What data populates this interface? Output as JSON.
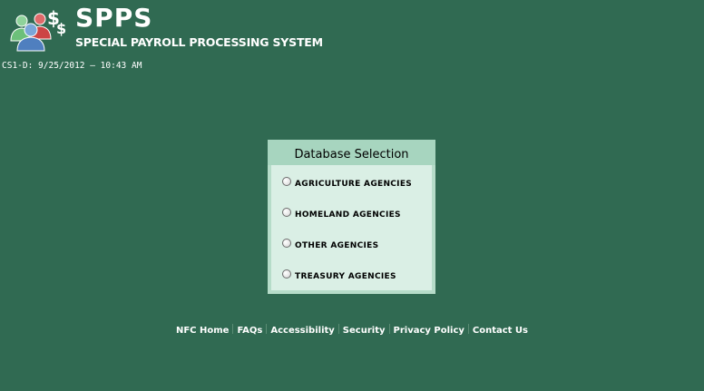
{
  "header": {
    "brand_title": "SPPS",
    "brand_subtitle": "SPECIAL PAYROLL PROCESSING SYSTEM",
    "server_stamp": "CS1-D: 9/25/2012 — 10:43 AM",
    "logo_icon": "people-with-dollar-signs-icon"
  },
  "database_selection": {
    "title": "Database Selection",
    "options": [
      {
        "label": "AGRICULTURE AGENCIES",
        "selected": false
      },
      {
        "label": "HOMELAND AGENCIES",
        "selected": false
      },
      {
        "label": "OTHER AGENCIES",
        "selected": false
      },
      {
        "label": "TREASURY AGENCIES",
        "selected": false
      }
    ]
  },
  "footer": {
    "links": [
      {
        "label": "NFC Home"
      },
      {
        "label": "FAQs"
      },
      {
        "label": "Accessibility"
      },
      {
        "label": "Security"
      },
      {
        "label": "Privacy Policy"
      },
      {
        "label": "Contact Us"
      }
    ]
  },
  "colors": {
    "background": "#306a52",
    "panel_header": "#a7d5bf",
    "panel_body": "#daefe5",
    "text_light": "#ffffff"
  }
}
